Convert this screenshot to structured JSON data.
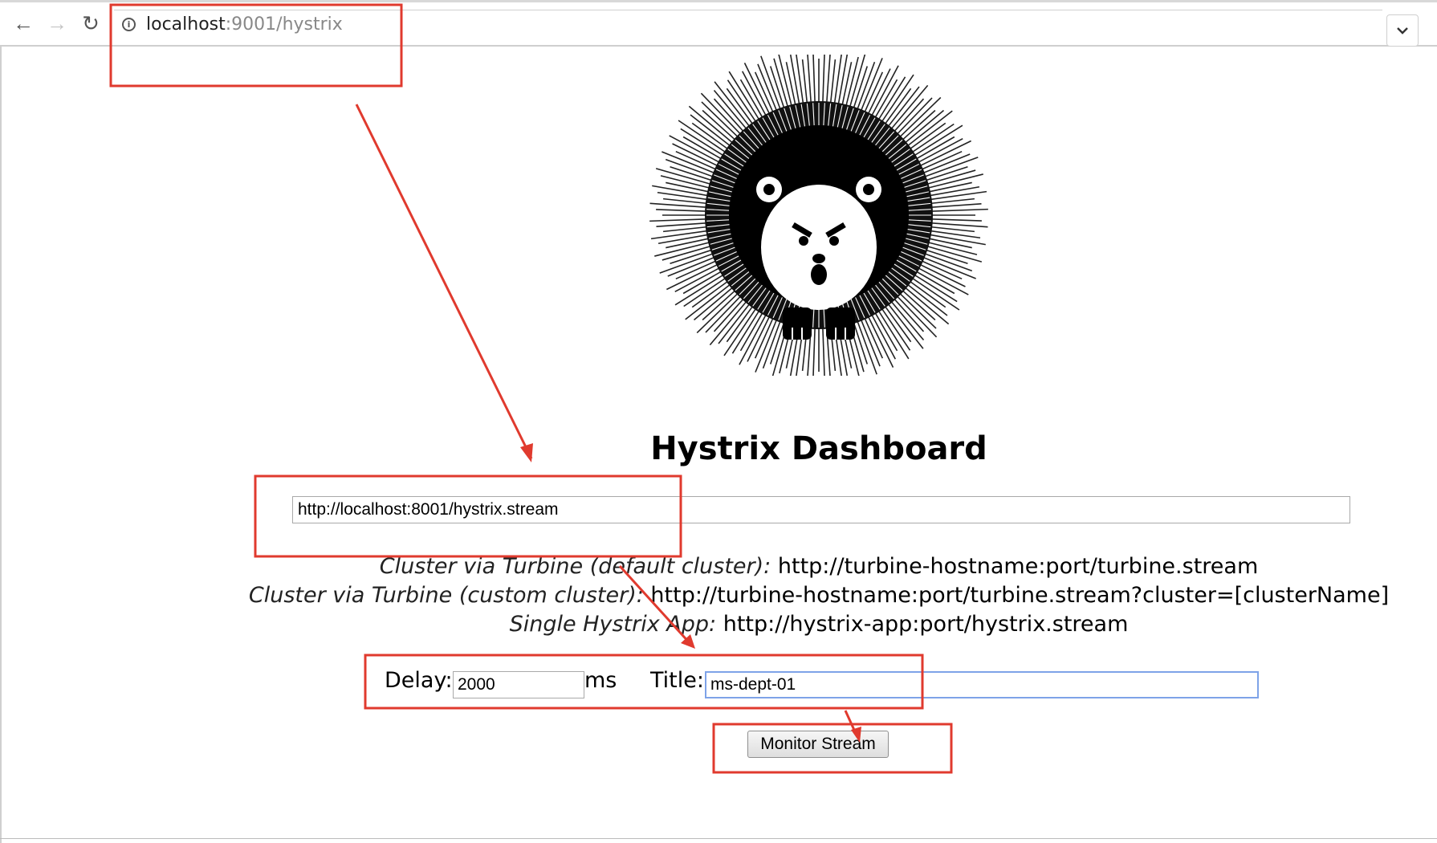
{
  "browser": {
    "url_host": "localhost",
    "url_path": ":9001/hystrix",
    "back_icon": "arrow-left-icon",
    "forward_icon": "arrow-right-icon",
    "reload_icon": "reload-icon",
    "info_icon": "info-icon",
    "menu_icon": "chevron-down-icon"
  },
  "page": {
    "title": "Hystrix Dashboard",
    "stream_url_value": "http://localhost:8001/hystrix.stream",
    "examples": [
      {
        "label": "Cluster via Turbine (default cluster):",
        "value": " http://turbine-hostname:port/turbine.stream"
      },
      {
        "label": "Cluster via Turbine (custom cluster):",
        "value": " http://turbine-hostname:port/turbine.stream?cluster=[clusterName]"
      },
      {
        "label": "Single Hystrix App:",
        "value": " http://hystrix-app:port/hystrix.stream"
      }
    ],
    "delay_label": "Delay:",
    "delay_value": "2000",
    "ms_label": "ms",
    "title_label": "Title:",
    "title_value": "ms-dept-01",
    "monitor_button": "Monitor Stream"
  },
  "colors": {
    "annotation_red": "#e03a2e",
    "focus_blue": "#7ea3e8"
  }
}
